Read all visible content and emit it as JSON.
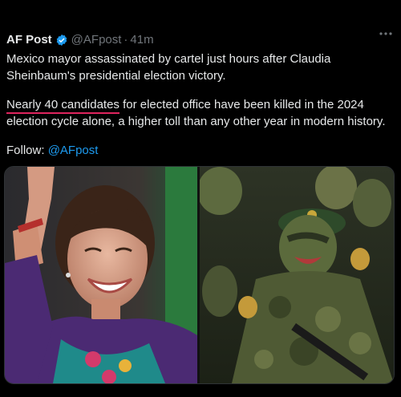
{
  "tweet": {
    "author_name": "AF Post",
    "handle": "@AFpost",
    "separator": "·",
    "time": "41m",
    "more_icon": "more-horizontal-icon",
    "verified_icon": "verified-badge-icon",
    "line1": "Mexico mayor assassinated by cartel just hours after Claudia Sheinbaum's presidential election victory.",
    "line2_underlined": "Nearly 40 candidates",
    "line2_rest": " for elected office have been killed in the 2024 election cycle alone, a higher toll than any other year in modern history.",
    "follow_label": "Follow: ",
    "follow_handle": "@AFpost"
  },
  "colors": {
    "background": "#000000",
    "text": "#e7e9ea",
    "muted": "#71767b",
    "link": "#1d9bf0",
    "underline": "#e0245e"
  }
}
